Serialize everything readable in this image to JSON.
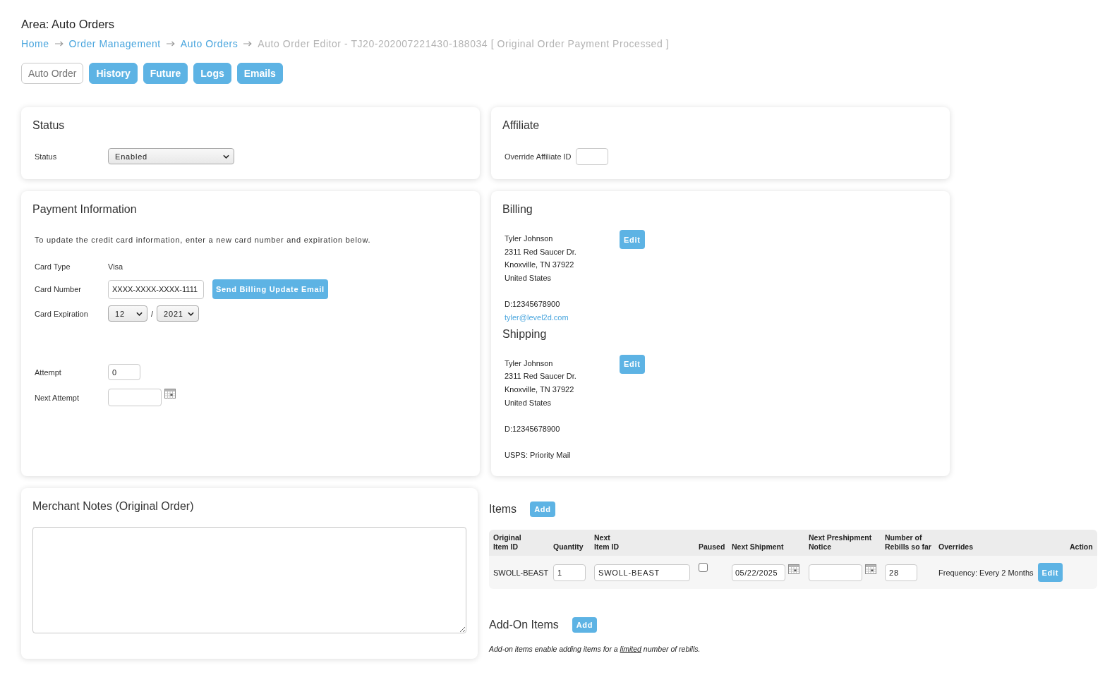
{
  "area_title": "Area: Auto Orders",
  "breadcrumb": [
    {
      "label": "Home",
      "kind": "link"
    },
    {
      "label": "Order Management",
      "kind": "link"
    },
    {
      "label": "Auto Orders",
      "kind": "link"
    },
    {
      "label": "Auto Order Editor - TJ20-202007221430-188034 [ Original Order Payment Processed ]",
      "kind": "current"
    }
  ],
  "tabs": [
    {
      "label": "Auto Order",
      "selected": true
    },
    {
      "label": "History",
      "selected": false
    },
    {
      "label": "Future",
      "selected": false
    },
    {
      "label": "Logs",
      "selected": false
    },
    {
      "label": "Emails",
      "selected": false
    }
  ],
  "status_panel": {
    "title": "Status",
    "field": {
      "label": "Status",
      "value": "Enabled"
    }
  },
  "affiliate_panel": {
    "title": "Affiliate",
    "field": {
      "label": "Override Affiliate ID"
    }
  },
  "payment_panel": {
    "title": "Payment Information",
    "note": "To update the credit card information, enter a new card number and expiration below.",
    "card_fields": [
      {
        "kind": "text",
        "label": "Card Type",
        "value": "Visa"
      },
      {
        "kind": "input-with-button",
        "label": "Card Number",
        "value": "XXXX-XXXX-XXXX-1111",
        "button": "Send Billing Update Email"
      },
      {
        "kind": "expiry",
        "label": "Card Expiration",
        "month": "12",
        "separator": "/",
        "year": "2021"
      }
    ],
    "retry_fields": [
      {
        "kind": "number",
        "label": "Attempt",
        "value": "0"
      },
      {
        "kind": "date",
        "label": "Next Attempt"
      }
    ]
  },
  "address_panel": {
    "sections": [
      {
        "title": "Billing",
        "address_lines": [
          "Tyler Johnson",
          "2311 Red Saucer Dr.",
          "Knoxville, TN 37922",
          "United States"
        ],
        "details": [
          {
            "kind": "phone",
            "text": "D:12345678900"
          },
          {
            "kind": "email",
            "text": "tyler@level2d.com"
          }
        ],
        "edit_button": "Edit"
      },
      {
        "title": "Shipping",
        "address_lines": [
          "Tyler Johnson",
          "2311 Red Saucer Dr.",
          "Knoxville, TN 37922",
          "United States"
        ],
        "details": [
          {
            "kind": "phone",
            "text": "D:12345678900"
          },
          {
            "kind": "method",
            "text": "USPS: Priority Mail"
          }
        ],
        "edit_button": "Edit"
      }
    ]
  },
  "merchant_notes": {
    "title": "Merchant Notes (Original Order)"
  },
  "items": {
    "title": "Items",
    "add_button": "Add",
    "columns": [
      "Original\nItem ID",
      "Quantity",
      "Next\nItem ID",
      "Paused",
      "Next Shipment",
      "Next Preshipment\nNotice",
      "Number of\nRebills so far",
      "Overrides",
      "Action"
    ],
    "rows": [
      {
        "original_item_id": "SWOLL-BEAST",
        "quantity": "1",
        "next_item_id": "SWOLL-BEAST",
        "paused": false,
        "next_shipment": "05/22/2025",
        "rebills_so_far": "28",
        "overrides": "Frequency: Every 2 Months",
        "edit_button": "Edit"
      }
    ]
  },
  "add_on_items": {
    "title": "Add-On Items",
    "add_button": "Add",
    "note": {
      "text_before": "Add-on items enable adding items for a ",
      "underlined_term": "limited",
      "text_after": " number of rebills."
    }
  }
}
